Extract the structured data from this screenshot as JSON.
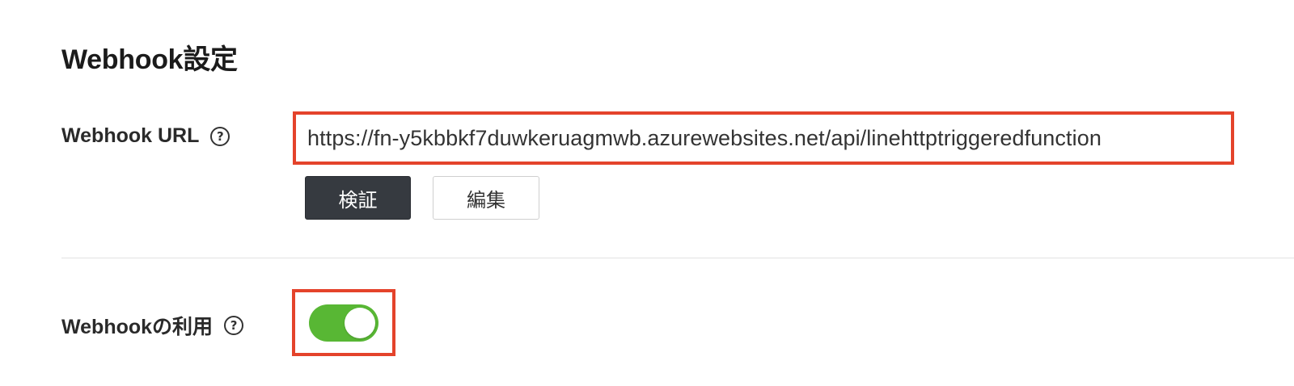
{
  "section": {
    "title": "Webhook設定"
  },
  "webhook_url": {
    "label": "Webhook URL",
    "help_glyph": "?",
    "value": "https://fn-y5kbbkf7duwkeruagmwb.azurewebsites.net/api/linehttptriggeredfunction",
    "verify_label": "検証",
    "edit_label": "編集"
  },
  "webhook_usage": {
    "label": "Webhookの利用",
    "help_glyph": "?",
    "enabled": true
  },
  "colors": {
    "highlight": "#e4432b",
    "toggle_on": "#58b734",
    "primary_button": "#363a40"
  },
  "icons": {
    "help": "help-circle-icon"
  }
}
